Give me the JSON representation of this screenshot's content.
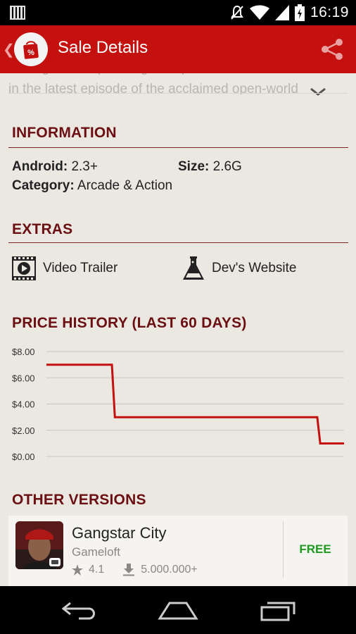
{
  "status_bar": {
    "time": "16:19"
  },
  "action_bar": {
    "title": "Sale Details"
  },
  "description": {
    "line1": "...the game... upcoming the open...",
    "line2": "in the latest episode of the acclaimed open-world"
  },
  "information": {
    "heading": "INFORMATION",
    "android_label": "Android:",
    "android_value": "2.3+",
    "size_label": "Size:",
    "size_value": "2.6G",
    "category_label": "Category:",
    "category_value": "Arcade & Action"
  },
  "extras": {
    "heading": "EXTRAS",
    "video_trailer": "Video Trailer",
    "dev_website": "Dev's Website"
  },
  "price_history": {
    "heading": "PRICE HISTORY (LAST 60 DAYS)"
  },
  "chart_data": {
    "type": "line",
    "title": "PRICE HISTORY (LAST 60 DAYS)",
    "xlabel": "",
    "ylabel": "",
    "ylim": [
      0,
      8
    ],
    "yticks": [
      "$8.00",
      "$6.00",
      "$4.00",
      "$2.00",
      "$0.00"
    ],
    "ytick_values": [
      8,
      6,
      4,
      2,
      0
    ],
    "x": [
      0,
      22,
      23,
      91,
      92,
      100
    ],
    "xlim": [
      0,
      100
    ],
    "series": [
      {
        "values": [
          6.99,
          6.99,
          2.99,
          2.99,
          0.99,
          0.99
        ],
        "color": "#c4100f"
      }
    ],
    "grid": true
  },
  "other_versions": {
    "heading": "OTHER VERSIONS",
    "items": [
      {
        "name": "Gangstar City",
        "developer": "Gameloft",
        "rating": "4.1",
        "downloads": "5.000.000+",
        "price": "FREE"
      }
    ]
  },
  "colors": {
    "primary": "#c4100f",
    "heading": "#6b0f12",
    "background": "#ebe8e2",
    "free": "#1e9b1e"
  },
  "icons": [
    "notification-icon",
    "mute-icon",
    "wifi-icon",
    "signal-icon",
    "battery-icon",
    "up-caret-icon",
    "sale-bag-icon",
    "share-icon",
    "chevron-down-icon",
    "video-icon",
    "flask-icon",
    "star-icon",
    "download-icon",
    "back-icon",
    "home-icon",
    "recents-icon"
  ]
}
